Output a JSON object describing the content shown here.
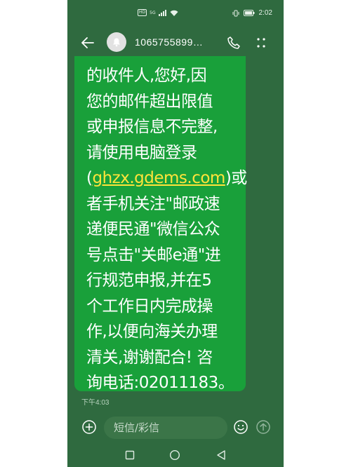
{
  "status_bar": {
    "network_badge": "HD",
    "signal_label": "5G",
    "time": "2:02"
  },
  "header": {
    "contact": "1065755899…"
  },
  "message": {
    "lines": [
      "的收件人,您好,因",
      "您的邮件超出限值",
      "或申报信息不完整,",
      "请使用电脑登录"
    ],
    "link_open": "(",
    "link_text": "ghzx.gdems.com",
    "link_close": ")或",
    "lines_after": [
      "者手机关注\"邮政速",
      "递便民通\"微信公众",
      "号点击\"关邮e通\"进",
      "行规范申报,并在5",
      "个工作日内完成操",
      "作,以便向海关办理",
      "清关,谢谢配合! 咨",
      "询电话:02011183。"
    ],
    "timestamp": "下午4:03"
  },
  "compose": {
    "placeholder": "短信/彩信"
  },
  "colors": {
    "background": "#2f6a3f",
    "bubble": "#19a03a",
    "link": "#ffe43a"
  },
  "icons": {
    "back": "arrow-left-icon",
    "avatar": "bell-icon",
    "call": "phone-icon",
    "more": "more-dots-icon",
    "add": "plus-circle-icon",
    "emoji": "smiley-icon",
    "send": "send-arrow-icon",
    "recent": "square-icon",
    "home": "circle-icon",
    "nav_back": "triangle-back-icon"
  }
}
